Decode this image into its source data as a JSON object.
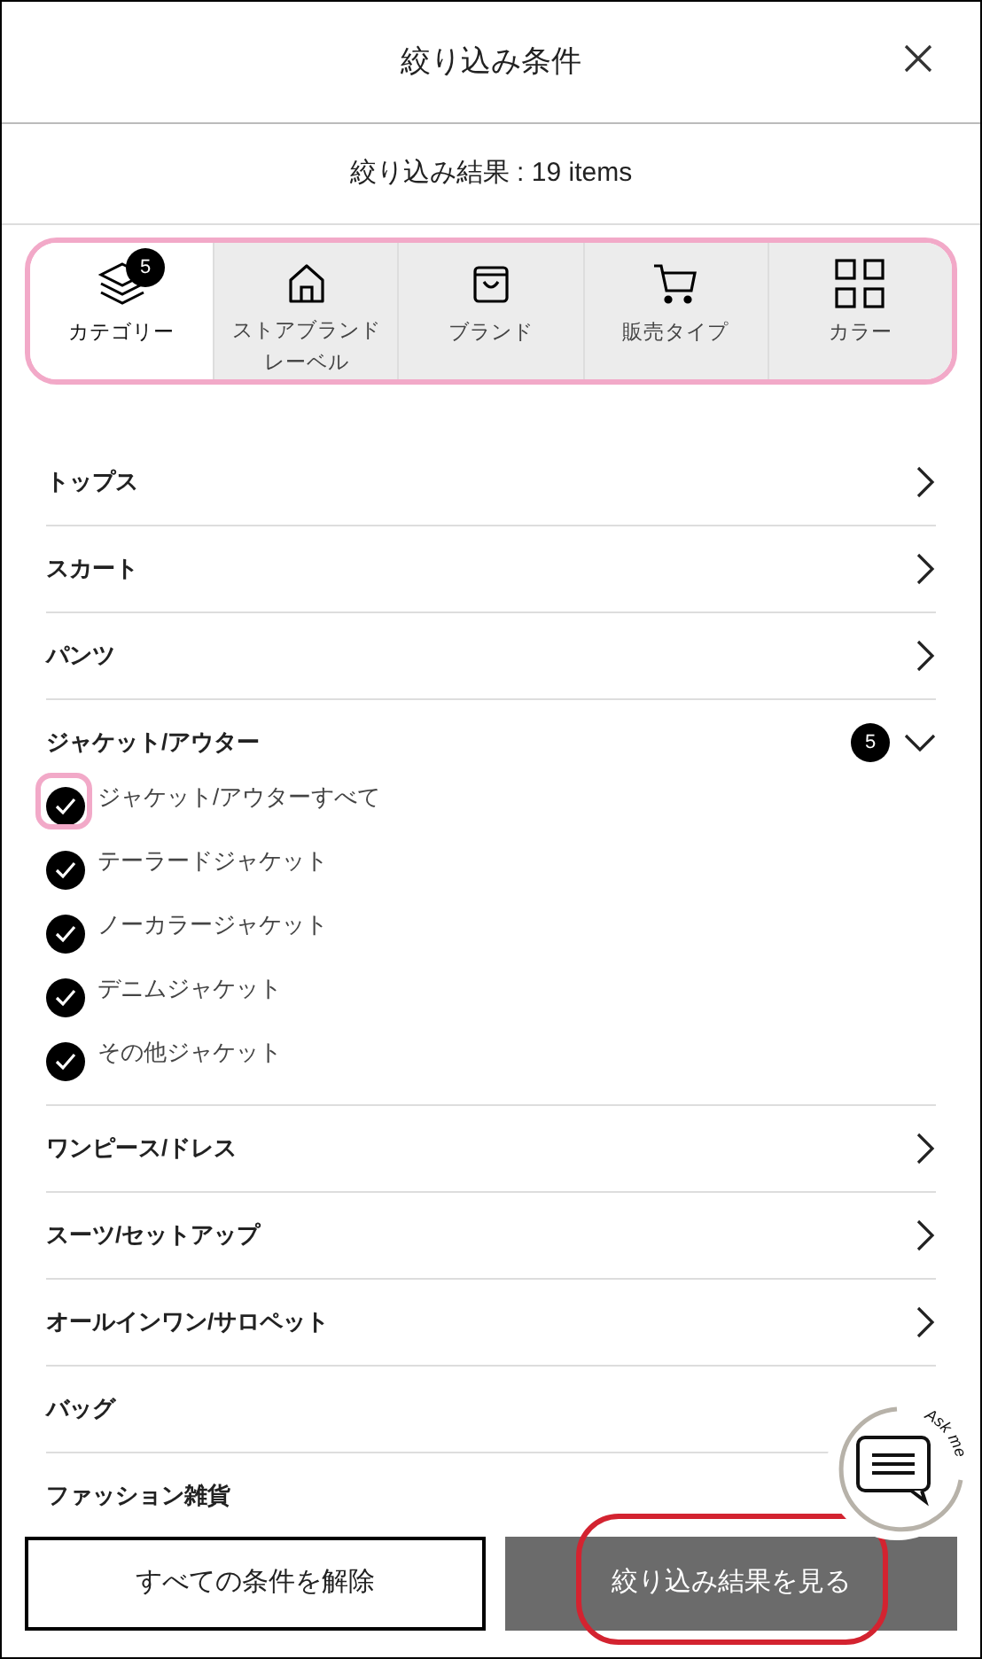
{
  "header": {
    "title": "絞り込み条件"
  },
  "result": {
    "text": "絞り込み結果 : 19 items"
  },
  "tabs": [
    {
      "label": "カテゴリー",
      "selected": true,
      "badge": "5"
    },
    {
      "label": "ストアブランドレーベル",
      "selected": false
    },
    {
      "label": "ブランド",
      "selected": false
    },
    {
      "label": "販売タイプ",
      "selected": false
    },
    {
      "label": "カラー",
      "selected": false
    }
  ],
  "categories": [
    {
      "label": "トップス",
      "expanded": false
    },
    {
      "label": "スカート",
      "expanded": false
    },
    {
      "label": "パンツ",
      "expanded": false
    },
    {
      "label": "ジャケット/アウター",
      "expanded": true,
      "badge": "5",
      "children": [
        {
          "label": "ジャケット/アウターすべて",
          "checked": true
        },
        {
          "label": "テーラードジャケット",
          "checked": true
        },
        {
          "label": "ノーカラージャケット",
          "checked": true
        },
        {
          "label": "デニムジャケット",
          "checked": true
        },
        {
          "label": "その他ジャケット",
          "checked": true
        }
      ]
    },
    {
      "label": "ワンピース/ドレス",
      "expanded": false
    },
    {
      "label": "スーツ/セットアップ",
      "expanded": false
    },
    {
      "label": "オールインワン/サロペット",
      "expanded": false
    },
    {
      "label": "バッグ"
    },
    {
      "label": "ファッション雑貨"
    }
  ],
  "chat": {
    "label": "Ask me"
  },
  "buttons": {
    "clear": "すべての条件を解除",
    "apply": "絞り込み結果を見る"
  }
}
